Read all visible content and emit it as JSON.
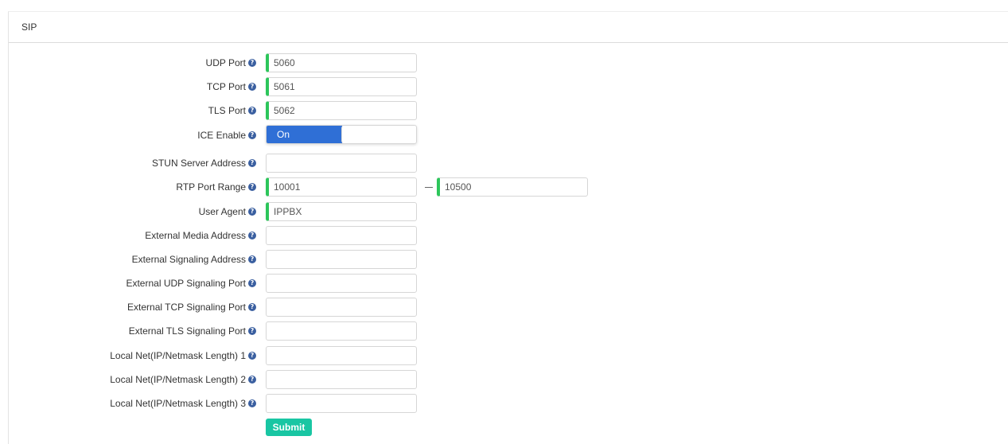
{
  "section": {
    "title": "SIP"
  },
  "fields": {
    "udp_port": {
      "label": "UDP Port",
      "value": "5060"
    },
    "tcp_port": {
      "label": "TCP Port",
      "value": "5061"
    },
    "tls_port": {
      "label": "TLS Port",
      "value": "5062"
    },
    "ice_enable": {
      "label": "ICE Enable",
      "value": "On"
    },
    "stun_server": {
      "label": "STUN Server Address",
      "value": ""
    },
    "rtp_port_range": {
      "label": "RTP Port Range",
      "start": "10001",
      "end": "10500"
    },
    "user_agent": {
      "label": "User Agent",
      "value": "IPPBX"
    },
    "ext_media_address": {
      "label": "External Media Address",
      "value": ""
    },
    "ext_signaling_address": {
      "label": "External Signaling Address",
      "value": ""
    },
    "ext_udp_signaling_port": {
      "label": "External UDP Signaling Port",
      "value": ""
    },
    "ext_tcp_signaling_port": {
      "label": "External TCP Signaling Port",
      "value": ""
    },
    "ext_tls_signaling_port": {
      "label": "External TLS Signaling Port",
      "value": ""
    },
    "local_net_1": {
      "label": "Local Net(IP/Netmask Length) 1",
      "value": ""
    },
    "local_net_2": {
      "label": "Local Net(IP/Netmask Length) 2",
      "value": ""
    },
    "local_net_3": {
      "label": "Local Net(IP/Netmask Length) 3",
      "value": ""
    }
  },
  "help_icon_glyph": "?",
  "submit_label": "Submit",
  "colors": {
    "required_marker": "#2dc65b",
    "toggle_on": "#2f6fd6",
    "submit": "#19c6a3",
    "help_icon": "#3a5fa0"
  }
}
